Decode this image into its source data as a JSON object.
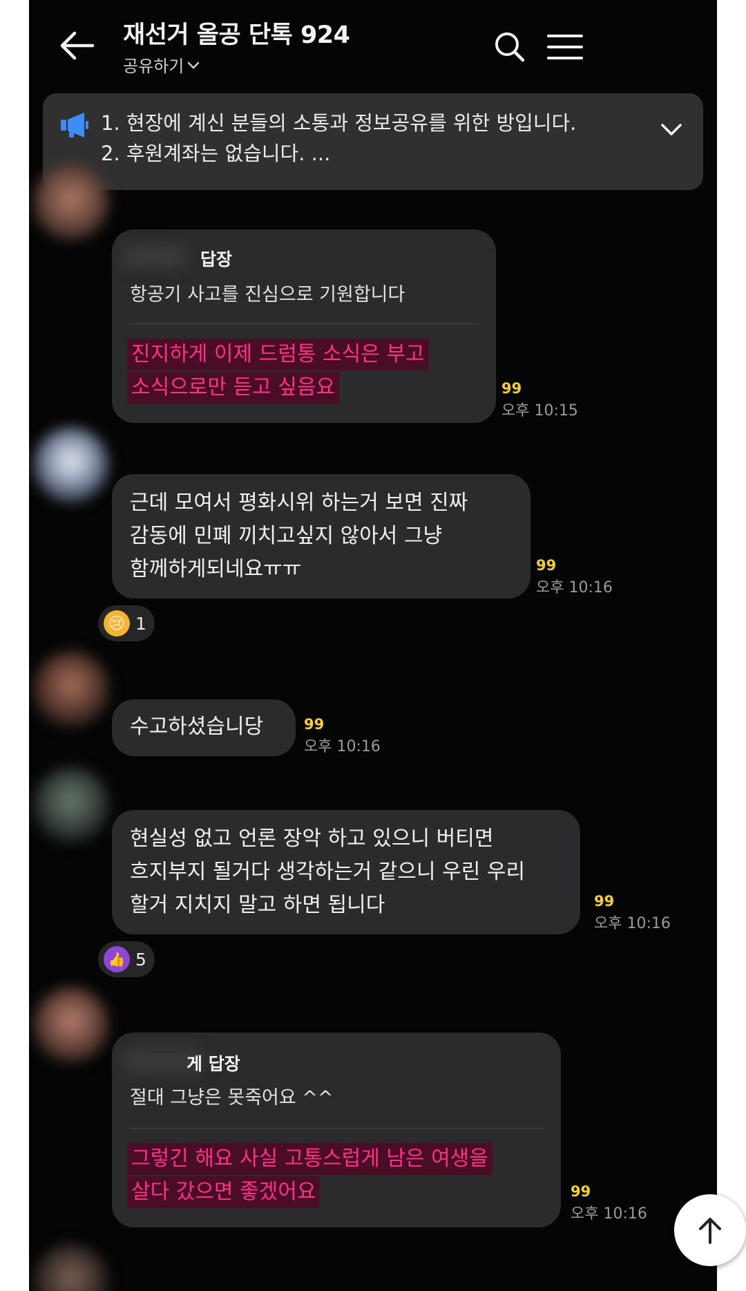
{
  "header": {
    "title": "재선거 올공 단톡 924",
    "subtitle": "공유하기",
    "icons": [
      "back-arrow-icon",
      "search-icon",
      "menu-icon"
    ]
  },
  "notice": {
    "line1": "1. 현장에 계신 분들의 소통과 정보공유를 위한 방입니다.",
    "line2": "2. 후원계좌는 없습니다.  ..."
  },
  "messages": [
    {
      "reply_to": "답장",
      "quote": "항공기 사고를 진심으로 기원합니다",
      "lines": [
        "진지하게 이제 드럼통 소식은 부고",
        "소식으로만 듣고 싶음요"
      ],
      "count": "99",
      "time": "오후 10:15"
    },
    {
      "lines": [
        "근데 모여서 평화시위 하는거 보면 진짜",
        "감동에 민폐 끼치고싶지 않아서 그냥",
        "함께하게되네요ㅠㅠ"
      ],
      "count": "99",
      "time": "오후 10:16",
      "reaction": {
        "emoji": "😢",
        "count": "1"
      }
    },
    {
      "lines": [
        "수고하셨습니당"
      ],
      "count": "99",
      "time": "오후 10:16"
    },
    {
      "lines": [
        "현실성 없고 언론 장악 하고 있으니 버티면",
        "흐지부지 될거다 생각하는거 같으니 우린 우리",
        "할거 지치지 말고 하면 됩니다"
      ],
      "count": "99",
      "time": "오후 10:16",
      "reaction": {
        "emoji": "👍",
        "count": "5"
      }
    },
    {
      "reply_to": "게 답장",
      "quote": "절대 그냥은 못죽어요 ^^",
      "lines": [
        "그렇긴 해요 사실 고통스럽게 남은 여생을",
        "살다 갔으면 좋겠어요"
      ],
      "count": "99",
      "time": "오후 10:16"
    }
  ],
  "colors": {
    "background": "#050505",
    "bubble": "#2b2b2d",
    "highlight_text": "#ff2f88",
    "read_count": "#f7d21c",
    "megaphone": "#3d8ef2"
  }
}
